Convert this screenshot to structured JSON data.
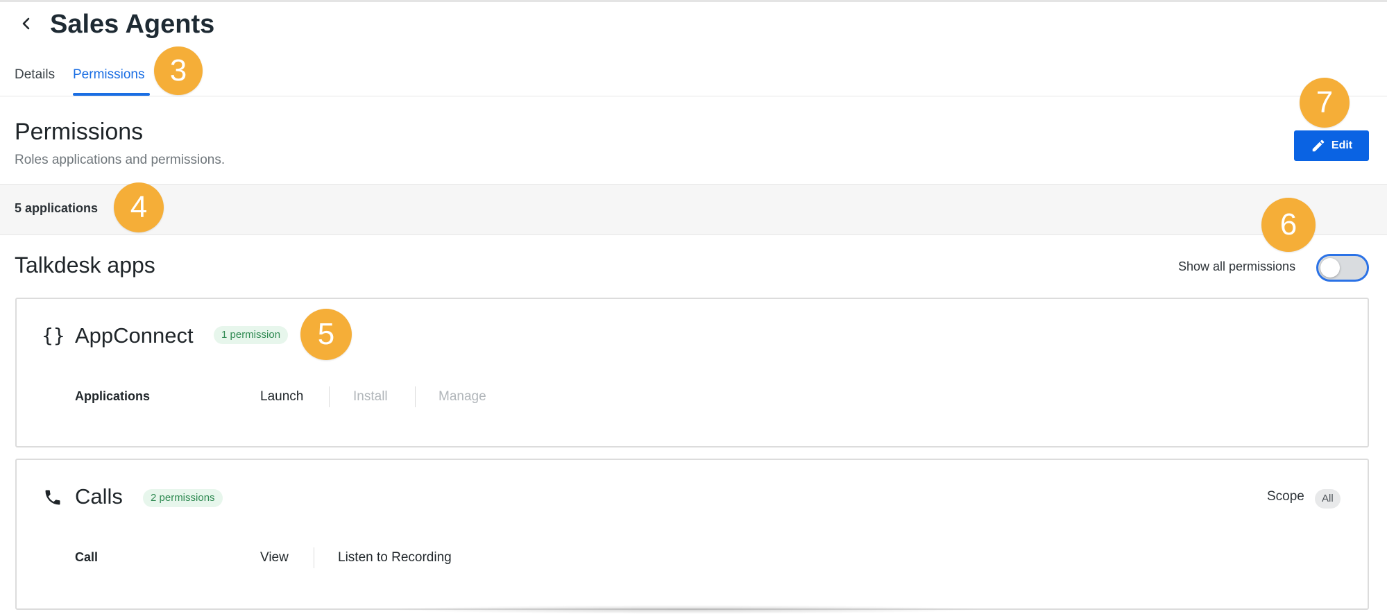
{
  "header": {
    "title": "Sales Agents",
    "back_icon": "chevron-left-icon"
  },
  "tabs": [
    {
      "label": "Details",
      "active": false
    },
    {
      "label": "Permissions",
      "active": true
    }
  ],
  "callouts": {
    "tabs": "3",
    "app_count": "4",
    "badge": "5",
    "toggle": "6",
    "edit": "7"
  },
  "permissions_section": {
    "title": "Permissions",
    "subtitle": "Roles applications and permissions.",
    "edit_label": "Edit",
    "edit_icon": "pencil-icon"
  },
  "apps_count_label": "5 applications",
  "group": {
    "title": "Talkdesk apps",
    "show_all_label": "Show all permissions",
    "show_all_enabled": false
  },
  "apps": [
    {
      "name": "AppConnect",
      "icon": "braces-icon",
      "icon_glyph": "{}",
      "badge": "1 permission",
      "rows": [
        {
          "label": "Applications",
          "permissions": [
            {
              "label": "Launch",
              "enabled": true
            },
            {
              "label": "Install",
              "enabled": false
            },
            {
              "label": "Manage",
              "enabled": false
            }
          ]
        }
      ]
    },
    {
      "name": "Calls",
      "icon": "phone-icon",
      "badge": "2 permissions",
      "scope_label": "Scope",
      "scope_value": "All",
      "rows": [
        {
          "label": "Call",
          "permissions": [
            {
              "label": "View",
              "enabled": true
            },
            {
              "label": "Listen to Recording",
              "enabled": true
            }
          ]
        }
      ]
    }
  ],
  "colors": {
    "accent": "#1a6ee3",
    "button": "#0a63e3",
    "callout": "#f5ae38",
    "badge_bg": "#e7f6ec",
    "badge_text": "#2f8a52"
  }
}
